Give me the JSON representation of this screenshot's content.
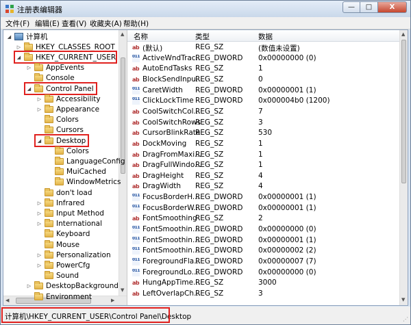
{
  "window": {
    "title": "注册表编辑器",
    "min_glyph": "—",
    "max_glyph": "□",
    "close_glyph": "X"
  },
  "menu": [
    "文件(F)",
    "编辑(E)",
    "查看(V)",
    "收藏夹(A)",
    "帮助(H)"
  ],
  "tree": [
    {
      "label": "计算机",
      "level": 0,
      "icon": "computer",
      "expander": "◢"
    },
    {
      "label": "HKEY_CLASSES_ROOT",
      "level": 1,
      "icon": "folder",
      "expander": "▷"
    },
    {
      "label": "HKEY_CURRENT_USER",
      "level": 1,
      "icon": "folder",
      "expander": "◢",
      "highlight": true
    },
    {
      "label": "AppEvents",
      "level": 2,
      "icon": "folder",
      "expander": "▷"
    },
    {
      "label": "Console",
      "level": 2,
      "icon": "folder",
      "expander": ""
    },
    {
      "label": "Control Panel",
      "level": 2,
      "icon": "folder",
      "expander": "◢",
      "highlight": true
    },
    {
      "label": "Accessibility",
      "level": 3,
      "icon": "folder",
      "expander": "▷"
    },
    {
      "label": "Appearance",
      "level": 3,
      "icon": "folder",
      "expander": "▷"
    },
    {
      "label": "Colors",
      "level": 3,
      "icon": "folder",
      "expander": ""
    },
    {
      "label": "Cursors",
      "level": 3,
      "icon": "folder",
      "expander": ""
    },
    {
      "label": "Desktop",
      "level": 3,
      "icon": "folder",
      "expander": "◢",
      "highlight": true
    },
    {
      "label": "Colors",
      "level": 4,
      "icon": "folder",
      "expander": ""
    },
    {
      "label": "LanguageConfig",
      "level": 4,
      "icon": "folder",
      "expander": ""
    },
    {
      "label": "MuiCached",
      "level": 4,
      "icon": "folder",
      "expander": ""
    },
    {
      "label": "WindowMetrics",
      "level": 4,
      "icon": "folder",
      "expander": ""
    },
    {
      "label": "don't load",
      "level": 3,
      "icon": "folder",
      "expander": ""
    },
    {
      "label": "Infrared",
      "level": 3,
      "icon": "folder",
      "expander": "▷"
    },
    {
      "label": "Input Method",
      "level": 3,
      "icon": "folder",
      "expander": "▷"
    },
    {
      "label": "International",
      "level": 3,
      "icon": "folder",
      "expander": "▷"
    },
    {
      "label": "Keyboard",
      "level": 3,
      "icon": "folder",
      "expander": ""
    },
    {
      "label": "Mouse",
      "level": 3,
      "icon": "folder",
      "expander": ""
    },
    {
      "label": "Personalization",
      "level": 3,
      "icon": "folder",
      "expander": "▷"
    },
    {
      "label": "PowerCfg",
      "level": 3,
      "icon": "folder",
      "expander": "▷"
    },
    {
      "label": "Sound",
      "level": 3,
      "icon": "folder",
      "expander": ""
    },
    {
      "label": "DesktopBackground",
      "level": 2,
      "icon": "folder",
      "expander": "▷"
    },
    {
      "label": "Environment",
      "level": 2,
      "icon": "folder",
      "expander": ""
    }
  ],
  "list": {
    "headers": {
      "name": "名称",
      "type": "类型",
      "data": "数据"
    },
    "rows": [
      {
        "name": "(默认)",
        "type": "REG_SZ",
        "data": "(数值未设置)",
        "icon": "ab"
      },
      {
        "name": "ActiveWndTrac...",
        "type": "REG_DWORD",
        "data": "0x00000000 (0)",
        "icon": "bin"
      },
      {
        "name": "AutoEndTasks",
        "type": "REG_SZ",
        "data": "1",
        "icon": "ab"
      },
      {
        "name": "BlockSendInpu...",
        "type": "REG_SZ",
        "data": "0",
        "icon": "ab"
      },
      {
        "name": "CaretWidth",
        "type": "REG_DWORD",
        "data": "0x00000001 (1)",
        "icon": "bin"
      },
      {
        "name": "ClickLockTime",
        "type": "REG_DWORD",
        "data": "0x000004b0 (1200)",
        "icon": "bin"
      },
      {
        "name": "CoolSwitchCol...",
        "type": "REG_SZ",
        "data": "7",
        "icon": "ab"
      },
      {
        "name": "CoolSwitchRows",
        "type": "REG_SZ",
        "data": "3",
        "icon": "ab"
      },
      {
        "name": "CursorBlinkRate",
        "type": "REG_SZ",
        "data": "530",
        "icon": "ab"
      },
      {
        "name": "DockMoving",
        "type": "REG_SZ",
        "data": "1",
        "icon": "ab"
      },
      {
        "name": "DragFromMaxi...",
        "type": "REG_SZ",
        "data": "1",
        "icon": "ab"
      },
      {
        "name": "DragFullWindo...",
        "type": "REG_SZ",
        "data": "1",
        "icon": "ab"
      },
      {
        "name": "DragHeight",
        "type": "REG_SZ",
        "data": "4",
        "icon": "ab"
      },
      {
        "name": "DragWidth",
        "type": "REG_SZ",
        "data": "4",
        "icon": "ab"
      },
      {
        "name": "FocusBorderH...",
        "type": "REG_DWORD",
        "data": "0x00000001 (1)",
        "icon": "bin"
      },
      {
        "name": "FocusBorderW...",
        "type": "REG_DWORD",
        "data": "0x00000001 (1)",
        "icon": "bin"
      },
      {
        "name": "FontSmoothing",
        "type": "REG_SZ",
        "data": "2",
        "icon": "ab"
      },
      {
        "name": "FontSmoothin...",
        "type": "REG_DWORD",
        "data": "0x00000000 (0)",
        "icon": "bin"
      },
      {
        "name": "FontSmoothin...",
        "type": "REG_DWORD",
        "data": "0x00000001 (1)",
        "icon": "bin"
      },
      {
        "name": "FontSmoothin...",
        "type": "REG_DWORD",
        "data": "0x00000002 (2)",
        "icon": "bin"
      },
      {
        "name": "ForegroundFla...",
        "type": "REG_DWORD",
        "data": "0x00000007 (7)",
        "icon": "bin"
      },
      {
        "name": "ForegroundLo...",
        "type": "REG_DWORD",
        "data": "0x00000000 (0)",
        "icon": "bin"
      },
      {
        "name": "HungAppTime...",
        "type": "REG_SZ",
        "data": "3000",
        "icon": "ab"
      },
      {
        "name": "LeftOverlapCh...",
        "type": "REG_SZ",
        "data": "3",
        "icon": "ab"
      }
    ]
  },
  "status": {
    "path": "计算机\\HKEY_CURRENT_USER\\Control Panel\\Desktop"
  }
}
